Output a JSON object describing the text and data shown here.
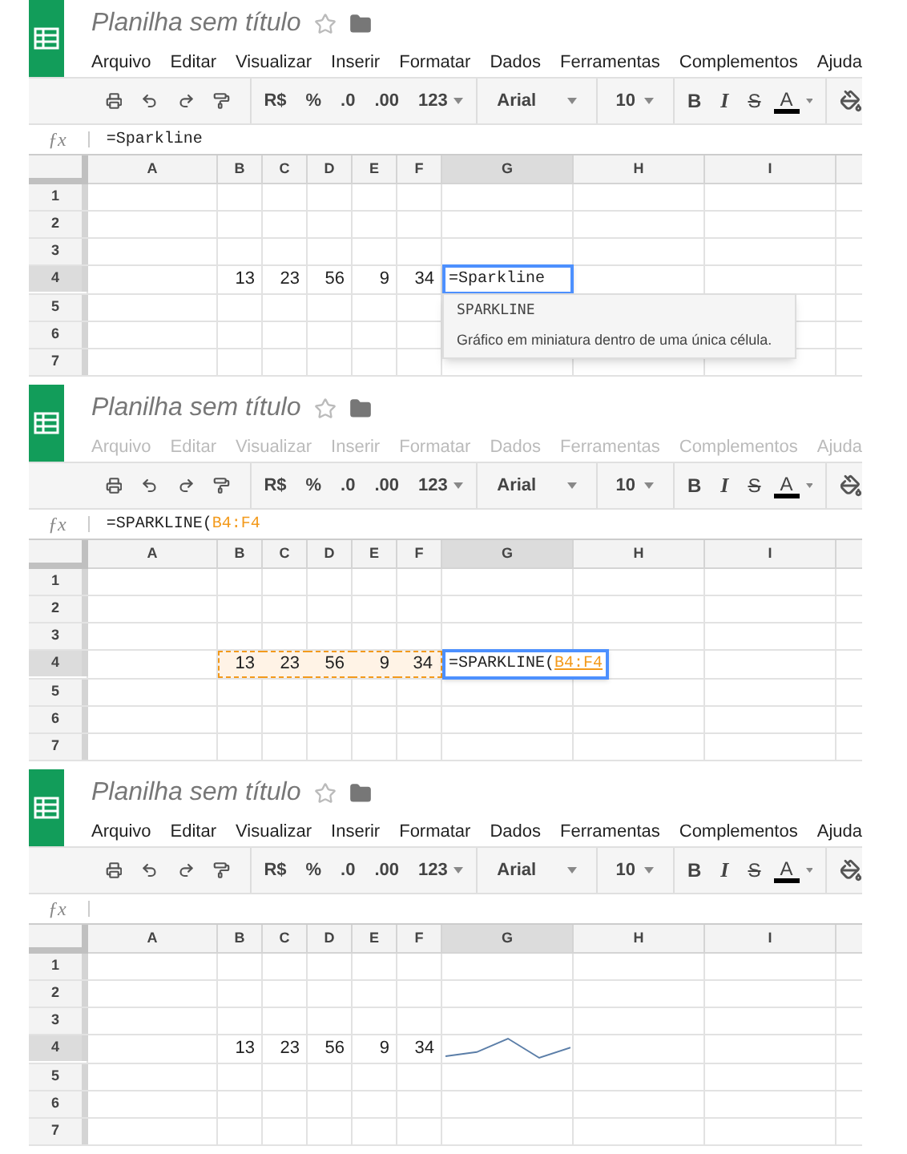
{
  "panels": [
    {
      "title": "Planilha sem título",
      "menus_disabled": false,
      "menus": [
        "Arquivo",
        "Editar",
        "Visualizar",
        "Inserir",
        "Formatar",
        "Dados",
        "Ferramentas",
        "Complementos",
        "Ajuda"
      ],
      "toolbar": {
        "currency": "R$",
        "percent": "%",
        "decrease_decimals": ".0",
        "increase_decimals": ".00",
        "number_format": "123",
        "font": "Arial",
        "font_size": "10",
        "bold": "B",
        "italic": "I",
        "strikethrough": "S",
        "text_color": "A"
      },
      "formula": {
        "label": "ƒx",
        "text": "=Sparkline"
      },
      "columns": [
        {
          "label": "A",
          "selected": false
        },
        {
          "label": "B",
          "selected": false
        },
        {
          "label": "C",
          "selected": false
        },
        {
          "label": "D",
          "selected": false
        },
        {
          "label": "E",
          "selected": false
        },
        {
          "label": "F",
          "selected": false
        },
        {
          "label": "G",
          "selected": true
        },
        {
          "label": "H",
          "selected": false
        },
        {
          "label": "I",
          "selected": false
        }
      ],
      "rows": [
        {
          "label": "1",
          "selected": false
        },
        {
          "label": "2",
          "selected": false
        },
        {
          "label": "3",
          "selected": false
        },
        {
          "label": "4",
          "selected": true,
          "cells": [
            {
              "kind": "empty"
            },
            {
              "kind": "number",
              "value": "13",
              "in_range": false
            },
            {
              "kind": "number",
              "value": "23",
              "in_range": false
            },
            {
              "kind": "number",
              "value": "56",
              "in_range": false
            },
            {
              "kind": "number",
              "value": "9",
              "in_range": false
            },
            {
              "kind": "number",
              "value": "34",
              "in_range": false
            },
            {
              "kind": "editor",
              "text": "=Sparkline"
            }
          ]
        },
        {
          "label": "5",
          "selected": false
        },
        {
          "label": "6",
          "selected": false
        },
        {
          "label": "7",
          "selected": false
        }
      ],
      "autocomplete": {
        "name": "SPARKLINE",
        "description": "Gráfico em miniatura dentro de uma única célula."
      }
    },
    {
      "title": "Planilha sem título",
      "menus_disabled": true,
      "menus": [
        "Arquivo",
        "Editar",
        "Visualizar",
        "Inserir",
        "Formatar",
        "Dados",
        "Ferramentas",
        "Complementos",
        "Ajuda"
      ],
      "toolbar": {
        "currency": "R$",
        "percent": "%",
        "decrease_decimals": ".0",
        "increase_decimals": ".00",
        "number_format": "123",
        "font": "Arial",
        "font_size": "10",
        "bold": "B",
        "italic": "I",
        "strikethrough": "S",
        "text_color": "A"
      },
      "formula": {
        "label": "ƒx",
        "text": "=SPARKLINE(",
        "range": "B4:F4"
      },
      "columns": [
        {
          "label": "A",
          "selected": false
        },
        {
          "label": "B",
          "selected": false
        },
        {
          "label": "C",
          "selected": false
        },
        {
          "label": "D",
          "selected": false
        },
        {
          "label": "E",
          "selected": false
        },
        {
          "label": "F",
          "selected": false
        },
        {
          "label": "G",
          "selected": true
        },
        {
          "label": "H",
          "selected": false
        },
        {
          "label": "I",
          "selected": false
        }
      ],
      "rows": [
        {
          "label": "1",
          "selected": false
        },
        {
          "label": "2",
          "selected": false
        },
        {
          "label": "3",
          "selected": false
        },
        {
          "label": "4",
          "selected": true,
          "cells": [
            {
              "kind": "empty"
            },
            {
              "kind": "number",
              "value": "13",
              "in_range": true
            },
            {
              "kind": "number",
              "value": "23",
              "in_range": true
            },
            {
              "kind": "number",
              "value": "56",
              "in_range": true
            },
            {
              "kind": "number",
              "value": "9",
              "in_range": true
            },
            {
              "kind": "number",
              "value": "34",
              "in_range": true
            },
            {
              "kind": "editor",
              "text": "=SPARKLINE(",
              "range": "B4:F4"
            }
          ]
        },
        {
          "label": "5",
          "selected": false
        },
        {
          "label": "6",
          "selected": false
        },
        {
          "label": "7",
          "selected": false
        }
      ]
    },
    {
      "title": "Planilha sem título",
      "menus_disabled": false,
      "menus": [
        "Arquivo",
        "Editar",
        "Visualizar",
        "Inserir",
        "Formatar",
        "Dados",
        "Ferramentas",
        "Complementos",
        "Ajuda"
      ],
      "toolbar": {
        "currency": "R$",
        "percent": "%",
        "decrease_decimals": ".0",
        "increase_decimals": ".00",
        "number_format": "123",
        "font": "Arial",
        "font_size": "10",
        "bold": "B",
        "italic": "I",
        "strikethrough": "S",
        "text_color": "A"
      },
      "formula": {
        "label": "ƒx"
      },
      "columns": [
        {
          "label": "A",
          "selected": false
        },
        {
          "label": "B",
          "selected": false
        },
        {
          "label": "C",
          "selected": false
        },
        {
          "label": "D",
          "selected": false
        },
        {
          "label": "E",
          "selected": false
        },
        {
          "label": "F",
          "selected": false
        },
        {
          "label": "G",
          "selected": true
        },
        {
          "label": "H",
          "selected": false
        },
        {
          "label": "I",
          "selected": false
        }
      ],
      "rows": [
        {
          "label": "1",
          "selected": false
        },
        {
          "label": "2",
          "selected": false
        },
        {
          "label": "3",
          "selected": false
        },
        {
          "label": "4",
          "selected": true,
          "cells": [
            {
              "kind": "empty"
            },
            {
              "kind": "number",
              "value": "13",
              "in_range": false
            },
            {
              "kind": "number",
              "value": "23",
              "in_range": false
            },
            {
              "kind": "number",
              "value": "56",
              "in_range": false
            },
            {
              "kind": "number",
              "value": "9",
              "in_range": false
            },
            {
              "kind": "number",
              "value": "34",
              "in_range": false
            },
            {
              "kind": "sparkline"
            }
          ]
        },
        {
          "label": "5",
          "selected": false
        },
        {
          "label": "6",
          "selected": false
        },
        {
          "label": "7",
          "selected": false
        }
      ]
    }
  ]
}
